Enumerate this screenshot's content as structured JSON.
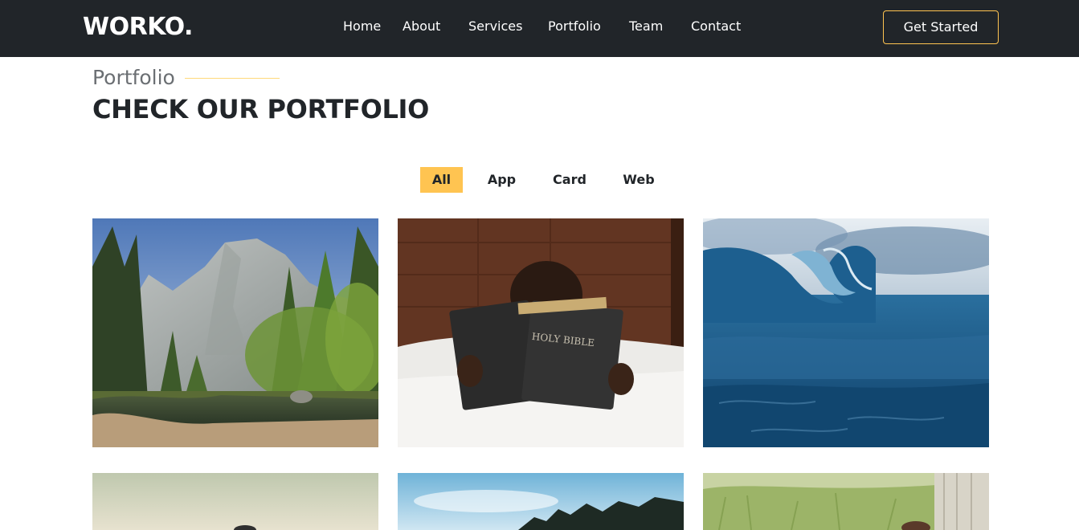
{
  "brand": {
    "logo": "WORKO."
  },
  "nav": {
    "items": [
      "Home",
      "About",
      "Services",
      "Portfolio",
      "Team",
      "Contact"
    ],
    "cta": "Get Started"
  },
  "section": {
    "subtitle": "Portfolio",
    "title": "CHECK OUR PORTFOLIO"
  },
  "filters": {
    "items": [
      "All",
      "App",
      "Card",
      "Web"
    ],
    "active": "All"
  },
  "colors": {
    "navbar": "#212529",
    "accent": "#ffc451"
  },
  "images": {
    "tile_1": "mountain-forest-river-photo",
    "tile_2": "child-reading-holy-bible-photo",
    "tile_3": "ocean-wave-photo",
    "tile_4": "hazy-sky-photo",
    "tile_5": "forest-sky-photo",
    "tile_6": "grass-field-photo"
  },
  "tile_2_text": "HOLY BIBLE"
}
